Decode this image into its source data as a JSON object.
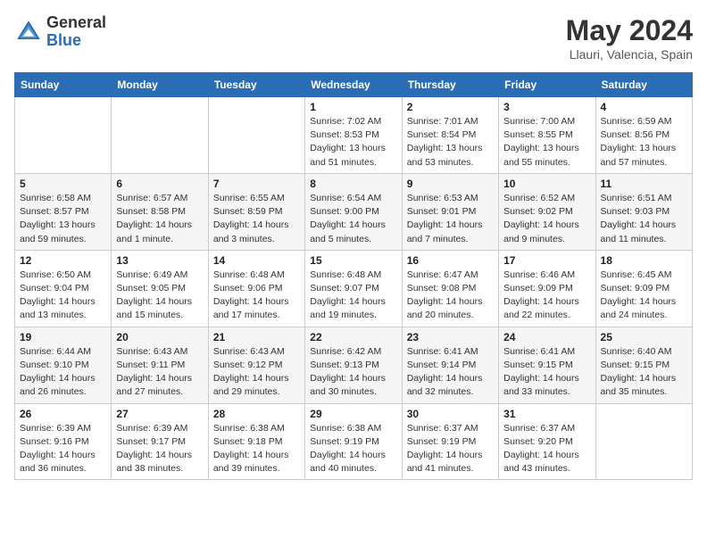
{
  "header": {
    "logo_line1": "General",
    "logo_line2": "Blue",
    "month_title": "May 2024",
    "location": "Llauri, Valencia, Spain"
  },
  "days_of_week": [
    "Sunday",
    "Monday",
    "Tuesday",
    "Wednesday",
    "Thursday",
    "Friday",
    "Saturday"
  ],
  "weeks": [
    [
      {
        "day": "",
        "sunrise": "",
        "sunset": "",
        "daylight": ""
      },
      {
        "day": "",
        "sunrise": "",
        "sunset": "",
        "daylight": ""
      },
      {
        "day": "",
        "sunrise": "",
        "sunset": "",
        "daylight": ""
      },
      {
        "day": "1",
        "sunrise": "Sunrise: 7:02 AM",
        "sunset": "Sunset: 8:53 PM",
        "daylight": "Daylight: 13 hours and 51 minutes."
      },
      {
        "day": "2",
        "sunrise": "Sunrise: 7:01 AM",
        "sunset": "Sunset: 8:54 PM",
        "daylight": "Daylight: 13 hours and 53 minutes."
      },
      {
        "day": "3",
        "sunrise": "Sunrise: 7:00 AM",
        "sunset": "Sunset: 8:55 PM",
        "daylight": "Daylight: 13 hours and 55 minutes."
      },
      {
        "day": "4",
        "sunrise": "Sunrise: 6:59 AM",
        "sunset": "Sunset: 8:56 PM",
        "daylight": "Daylight: 13 hours and 57 minutes."
      }
    ],
    [
      {
        "day": "5",
        "sunrise": "Sunrise: 6:58 AM",
        "sunset": "Sunset: 8:57 PM",
        "daylight": "Daylight: 13 hours and 59 minutes."
      },
      {
        "day": "6",
        "sunrise": "Sunrise: 6:57 AM",
        "sunset": "Sunset: 8:58 PM",
        "daylight": "Daylight: 14 hours and 1 minute."
      },
      {
        "day": "7",
        "sunrise": "Sunrise: 6:55 AM",
        "sunset": "Sunset: 8:59 PM",
        "daylight": "Daylight: 14 hours and 3 minutes."
      },
      {
        "day": "8",
        "sunrise": "Sunrise: 6:54 AM",
        "sunset": "Sunset: 9:00 PM",
        "daylight": "Daylight: 14 hours and 5 minutes."
      },
      {
        "day": "9",
        "sunrise": "Sunrise: 6:53 AM",
        "sunset": "Sunset: 9:01 PM",
        "daylight": "Daylight: 14 hours and 7 minutes."
      },
      {
        "day": "10",
        "sunrise": "Sunrise: 6:52 AM",
        "sunset": "Sunset: 9:02 PM",
        "daylight": "Daylight: 14 hours and 9 minutes."
      },
      {
        "day": "11",
        "sunrise": "Sunrise: 6:51 AM",
        "sunset": "Sunset: 9:03 PM",
        "daylight": "Daylight: 14 hours and 11 minutes."
      }
    ],
    [
      {
        "day": "12",
        "sunrise": "Sunrise: 6:50 AM",
        "sunset": "Sunset: 9:04 PM",
        "daylight": "Daylight: 14 hours and 13 minutes."
      },
      {
        "day": "13",
        "sunrise": "Sunrise: 6:49 AM",
        "sunset": "Sunset: 9:05 PM",
        "daylight": "Daylight: 14 hours and 15 minutes."
      },
      {
        "day": "14",
        "sunrise": "Sunrise: 6:48 AM",
        "sunset": "Sunset: 9:06 PM",
        "daylight": "Daylight: 14 hours and 17 minutes."
      },
      {
        "day": "15",
        "sunrise": "Sunrise: 6:48 AM",
        "sunset": "Sunset: 9:07 PM",
        "daylight": "Daylight: 14 hours and 19 minutes."
      },
      {
        "day": "16",
        "sunrise": "Sunrise: 6:47 AM",
        "sunset": "Sunset: 9:08 PM",
        "daylight": "Daylight: 14 hours and 20 minutes."
      },
      {
        "day": "17",
        "sunrise": "Sunrise: 6:46 AM",
        "sunset": "Sunset: 9:09 PM",
        "daylight": "Daylight: 14 hours and 22 minutes."
      },
      {
        "day": "18",
        "sunrise": "Sunrise: 6:45 AM",
        "sunset": "Sunset: 9:09 PM",
        "daylight": "Daylight: 14 hours and 24 minutes."
      }
    ],
    [
      {
        "day": "19",
        "sunrise": "Sunrise: 6:44 AM",
        "sunset": "Sunset: 9:10 PM",
        "daylight": "Daylight: 14 hours and 26 minutes."
      },
      {
        "day": "20",
        "sunrise": "Sunrise: 6:43 AM",
        "sunset": "Sunset: 9:11 PM",
        "daylight": "Daylight: 14 hours and 27 minutes."
      },
      {
        "day": "21",
        "sunrise": "Sunrise: 6:43 AM",
        "sunset": "Sunset: 9:12 PM",
        "daylight": "Daylight: 14 hours and 29 minutes."
      },
      {
        "day": "22",
        "sunrise": "Sunrise: 6:42 AM",
        "sunset": "Sunset: 9:13 PM",
        "daylight": "Daylight: 14 hours and 30 minutes."
      },
      {
        "day": "23",
        "sunrise": "Sunrise: 6:41 AM",
        "sunset": "Sunset: 9:14 PM",
        "daylight": "Daylight: 14 hours and 32 minutes."
      },
      {
        "day": "24",
        "sunrise": "Sunrise: 6:41 AM",
        "sunset": "Sunset: 9:15 PM",
        "daylight": "Daylight: 14 hours and 33 minutes."
      },
      {
        "day": "25",
        "sunrise": "Sunrise: 6:40 AM",
        "sunset": "Sunset: 9:15 PM",
        "daylight": "Daylight: 14 hours and 35 minutes."
      }
    ],
    [
      {
        "day": "26",
        "sunrise": "Sunrise: 6:39 AM",
        "sunset": "Sunset: 9:16 PM",
        "daylight": "Daylight: 14 hours and 36 minutes."
      },
      {
        "day": "27",
        "sunrise": "Sunrise: 6:39 AM",
        "sunset": "Sunset: 9:17 PM",
        "daylight": "Daylight: 14 hours and 38 minutes."
      },
      {
        "day": "28",
        "sunrise": "Sunrise: 6:38 AM",
        "sunset": "Sunset: 9:18 PM",
        "daylight": "Daylight: 14 hours and 39 minutes."
      },
      {
        "day": "29",
        "sunrise": "Sunrise: 6:38 AM",
        "sunset": "Sunset: 9:19 PM",
        "daylight": "Daylight: 14 hours and 40 minutes."
      },
      {
        "day": "30",
        "sunrise": "Sunrise: 6:37 AM",
        "sunset": "Sunset: 9:19 PM",
        "daylight": "Daylight: 14 hours and 41 minutes."
      },
      {
        "day": "31",
        "sunrise": "Sunrise: 6:37 AM",
        "sunset": "Sunset: 9:20 PM",
        "daylight": "Daylight: 14 hours and 43 minutes."
      },
      {
        "day": "",
        "sunrise": "",
        "sunset": "",
        "daylight": ""
      }
    ]
  ]
}
